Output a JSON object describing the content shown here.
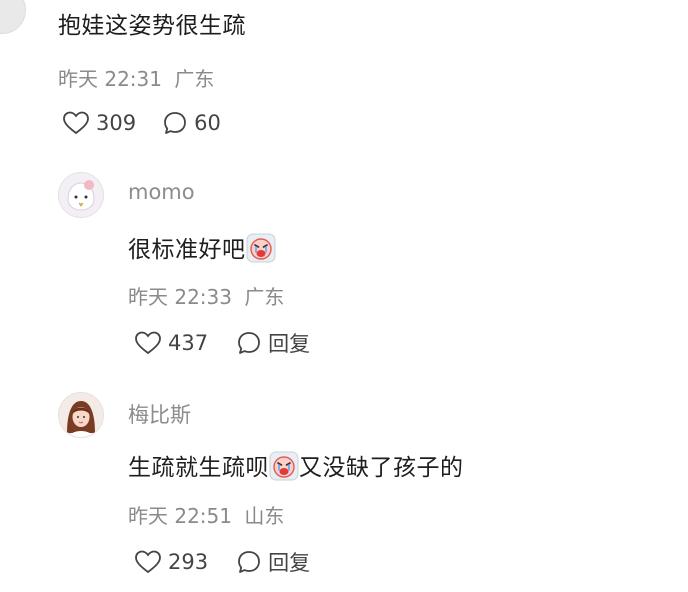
{
  "comments": [
    {
      "text": "抱娃这姿势很生疏",
      "time": "昨天 22:31",
      "location": "广东",
      "likes": "309",
      "replies_count": "60"
    }
  ],
  "replies": [
    {
      "username": "momo",
      "text_before_emoji": "很标准好吧",
      "text_after_emoji": "",
      "time": "昨天 22:33",
      "location": "广东",
      "likes": "437",
      "reply_label": "回复"
    },
    {
      "username": "梅比斯",
      "text_before_emoji": "生疏就生疏呗",
      "text_after_emoji": "又没缺了孩子的",
      "time": "昨天 22:51",
      "location": "山东",
      "likes": "293",
      "reply_label": "回复"
    }
  ],
  "colors": {
    "main_text": "#1e1e1e",
    "meta_text": "#8a8a8a",
    "username": "#8c8c8c",
    "emoji_face": "#ff6b6b"
  },
  "icons": [
    "heart-icon",
    "comment-bubble-icon",
    "crying-emoji-icon"
  ]
}
